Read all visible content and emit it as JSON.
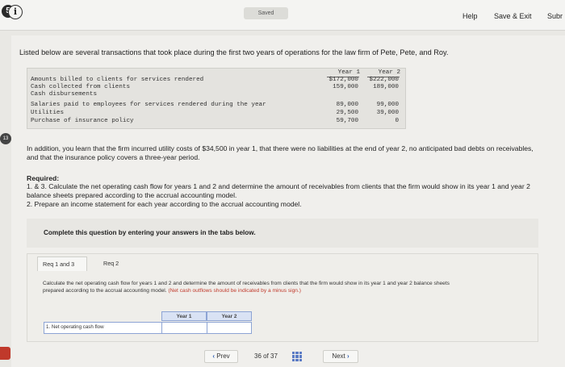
{
  "topbar": {
    "saved_label": "Saved",
    "help_label": "Help",
    "save_exit_label": "Save & Exit",
    "submit_label": "Subr"
  },
  "question_number": "5",
  "left_badge": "13",
  "intro": "Listed below are several transactions that took place during the first two years of operations for the law firm of Pete, Pete, and Roy.",
  "transactions": {
    "col_year1": "Year 1",
    "col_year2": "Year 2",
    "rows": [
      {
        "label": "Amounts billed to clients for services rendered",
        "year1": "$172,000",
        "year2": "$222,000"
      },
      {
        "label": "Cash collected from clients",
        "year1": "159,000",
        "year2": "189,000"
      },
      {
        "label": "Cash disbursements",
        "year1": "",
        "year2": ""
      },
      {
        "label": "Salaries paid to employees for services rendered during the year",
        "year1": "89,000",
        "year2": "99,000"
      },
      {
        "label": "Utilities",
        "year1": "29,500",
        "year2": "39,000"
      },
      {
        "label": "Purchase of insurance policy",
        "year1": "59,700",
        "year2": "0"
      }
    ]
  },
  "additional_info": "In addition, you learn that the firm incurred utility costs of $34,500 in year 1, that there were no liabilities at the end of year 2, no anticipated bad debts on receivables, and that the insurance policy covers a three-year period.",
  "required": {
    "heading": "Required:",
    "item1": "1. & 3. Calculate the net operating cash flow for years 1 and 2 and determine the amount of receivables from clients that the firm would show in its year 1 and year 2 balance sheets prepared according to the accrual accounting model.",
    "item2": "2. Prepare an income statement for each year according to the accrual accounting model."
  },
  "instruction": "Complete this question by entering your answers in the tabs below.",
  "tabs": [
    {
      "label": "Req 1 and 3"
    },
    {
      "label": "Req 2"
    }
  ],
  "tab_question": "Calculate the net operating cash flow for years 1 and 2 and determine the amount of receivables from clients that the firm would show in its year 1 and year 2 balance sheets prepared according to the accrual accounting model.",
  "tab_note": "(Net cash outflows should be indicated by a minus sign.)",
  "answer_table": {
    "col_year1": "Year 1",
    "col_year2": "Year 2",
    "row_number": "1.",
    "row_label": "Net operating cash flow",
    "year1_value": "",
    "year2_value": ""
  },
  "pager": {
    "prev_label": "Prev",
    "page_current": "36",
    "page_of": "of",
    "page_total": "37",
    "next_label": "Next"
  }
}
